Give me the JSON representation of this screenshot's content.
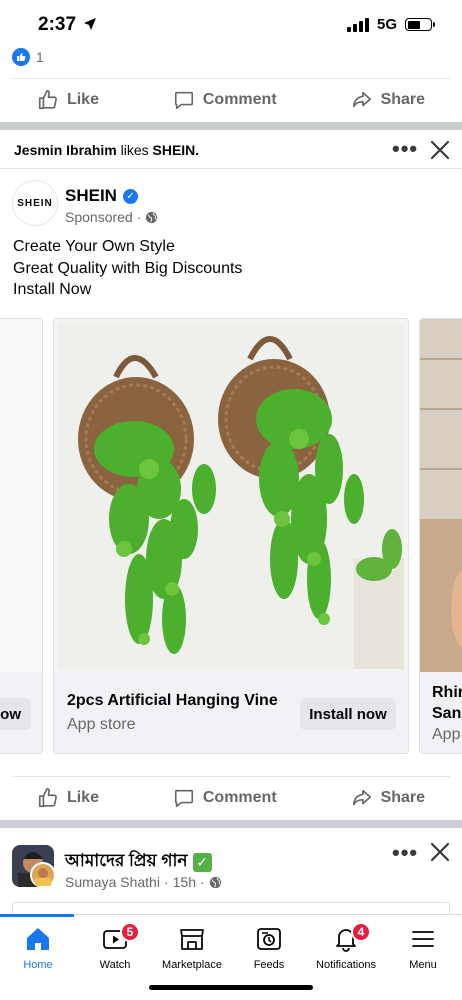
{
  "status_bar": {
    "time": "2:37",
    "network": "5G"
  },
  "prev_post": {
    "reaction_count": "1"
  },
  "actions": {
    "like": "Like",
    "comment": "Comment",
    "share": "Share"
  },
  "ad_post": {
    "context_user": "Jesmin Ibrahim",
    "context_verb": " likes ",
    "context_page": "SHEIN.",
    "page_logo_text": "SHEIN",
    "page_name": "SHEIN",
    "sponsored": "Sponsored",
    "separator": "·",
    "text_lines": [
      "Create Your Own Style",
      "Great Quality with Big Discounts",
      "Install Now"
    ],
    "carousel": {
      "left_partial_button": "ow",
      "main_card": {
        "title": "2pcs Artificial Hanging Vine",
        "subtitle": "App store",
        "button": "Install now"
      },
      "right_partial": {
        "title_line1": "Rhir",
        "title_line2": "San",
        "subtitle": "App"
      }
    }
  },
  "next_post": {
    "title": "আমাদের প্রিয় গান",
    "author": "Sumaya Shathi",
    "time": "15h",
    "separator": "·"
  },
  "tabbar": {
    "items": [
      {
        "label": "Home",
        "icon": "home-icon",
        "active": true
      },
      {
        "label": "Watch",
        "icon": "watch-icon",
        "badge": "5"
      },
      {
        "label": "Marketplace",
        "icon": "marketplace-icon"
      },
      {
        "label": "Feeds",
        "icon": "feeds-icon"
      },
      {
        "label": "Notifications",
        "icon": "bell-icon",
        "badge": "4"
      },
      {
        "label": "Menu",
        "icon": "menu-icon"
      }
    ]
  },
  "colors": {
    "brand": "#1877f2",
    "badge": "#e41e3f",
    "secondary_text": "#65676b",
    "separator": "#c9ccd1"
  }
}
